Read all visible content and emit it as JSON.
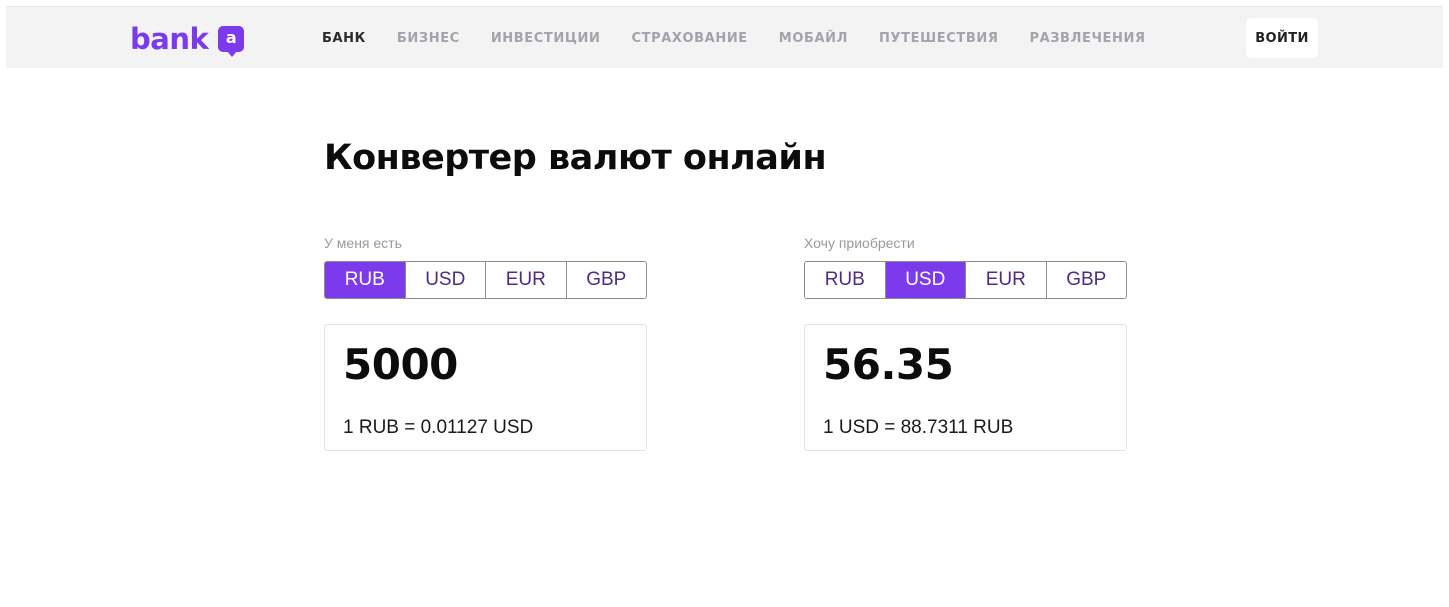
{
  "brand": {
    "name": "bank",
    "badge_letter": "a",
    "color": "#7c3aed"
  },
  "nav": {
    "items": [
      {
        "label": "БАНК",
        "active": true
      },
      {
        "label": "БИЗНЕС"
      },
      {
        "label": "ИНВЕСТИЦИИ"
      },
      {
        "label": "СТРАХОВАНИЕ"
      },
      {
        "label": "МОБАЙЛ"
      },
      {
        "label": "ПУТЕШЕСТВИЯ"
      },
      {
        "label": "РАЗВЛЕЧЕНИЯ"
      }
    ],
    "login_label": "ВОЙТИ"
  },
  "page": {
    "title": "Конвертер валют онлайн"
  },
  "converter": {
    "from": {
      "label": "У меня есть",
      "currencies": [
        "RUB",
        "USD",
        "EUR",
        "GBP"
      ],
      "selected": "RUB",
      "amount": "5000",
      "rate": "1 RUB = 0.01127 USD"
    },
    "to": {
      "label": "Хочу приобрести",
      "currencies": [
        "RUB",
        "USD",
        "EUR",
        "GBP"
      ],
      "selected": "USD",
      "amount": "56.35",
      "rate": "1 USD = 88.7311 RUB"
    }
  }
}
